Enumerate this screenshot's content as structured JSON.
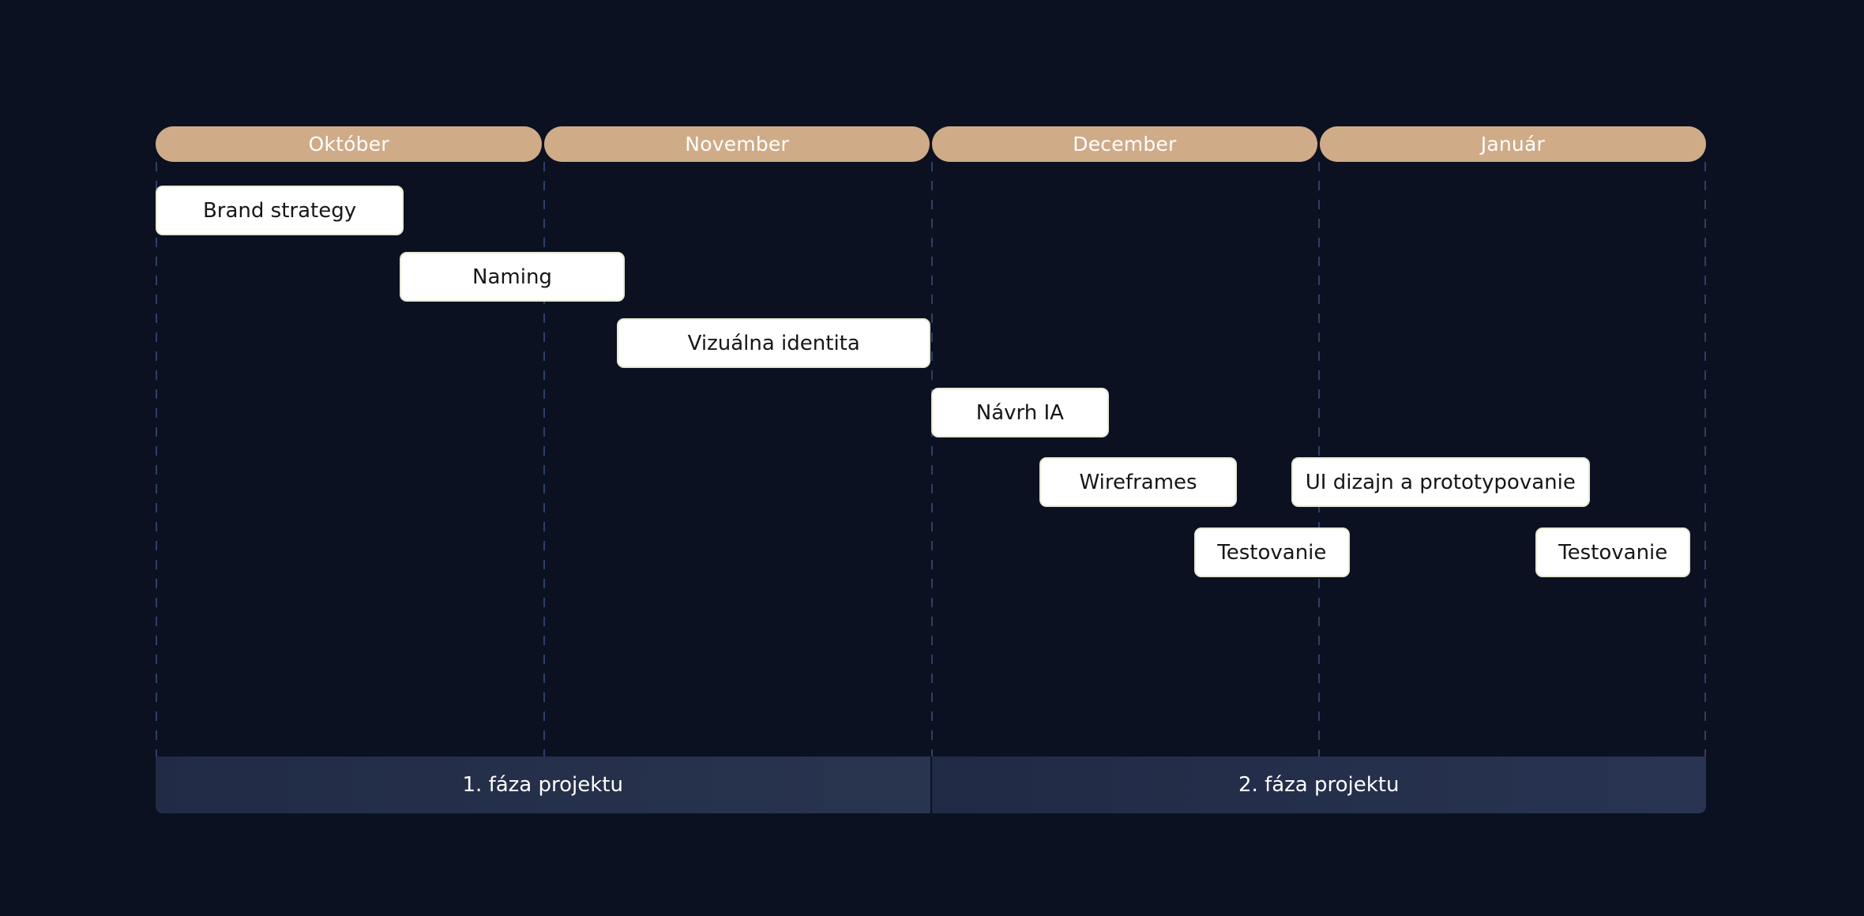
{
  "chart_data": {
    "type": "gantt",
    "title": "",
    "x_unit": "month",
    "x_range": [
      0,
      4
    ],
    "months": [
      "Október",
      "November",
      "December",
      "Január"
    ],
    "tasks": [
      {
        "label": "Brand strategy",
        "start": 0.0,
        "end": 0.64,
        "row": 0
      },
      {
        "label": "Naming",
        "start": 0.63,
        "end": 1.21,
        "row": 1
      },
      {
        "label": "Vizuálna identita",
        "start": 1.19,
        "end": 2.0,
        "row": 2
      },
      {
        "label": "Návrh IA",
        "start": 2.0,
        "end": 2.46,
        "row": 3
      },
      {
        "label": "Wireframes",
        "start": 2.28,
        "end": 2.79,
        "row": 4
      },
      {
        "label": "UI dizajn a prototypovanie",
        "start": 2.93,
        "end": 3.7,
        "row": 4
      },
      {
        "label": "Testovanie",
        "start": 2.68,
        "end": 3.08,
        "row": 5
      },
      {
        "label": "Testovanie",
        "start": 3.56,
        "end": 3.96,
        "row": 5
      }
    ],
    "phases": [
      {
        "label": "1. fáza projektu",
        "start": 0,
        "end": 2
      },
      {
        "label": "2. fáza projektu",
        "start": 2,
        "end": 4
      }
    ],
    "grid": "dashed vertical lines at month boundaries",
    "colors": {
      "background": "#0b1120",
      "month_bar": "#cfab88",
      "task_fill": "#ffffff",
      "task_text": "#161616",
      "phase_bar": "#252f4b",
      "grid_line": "#2c4068"
    }
  }
}
